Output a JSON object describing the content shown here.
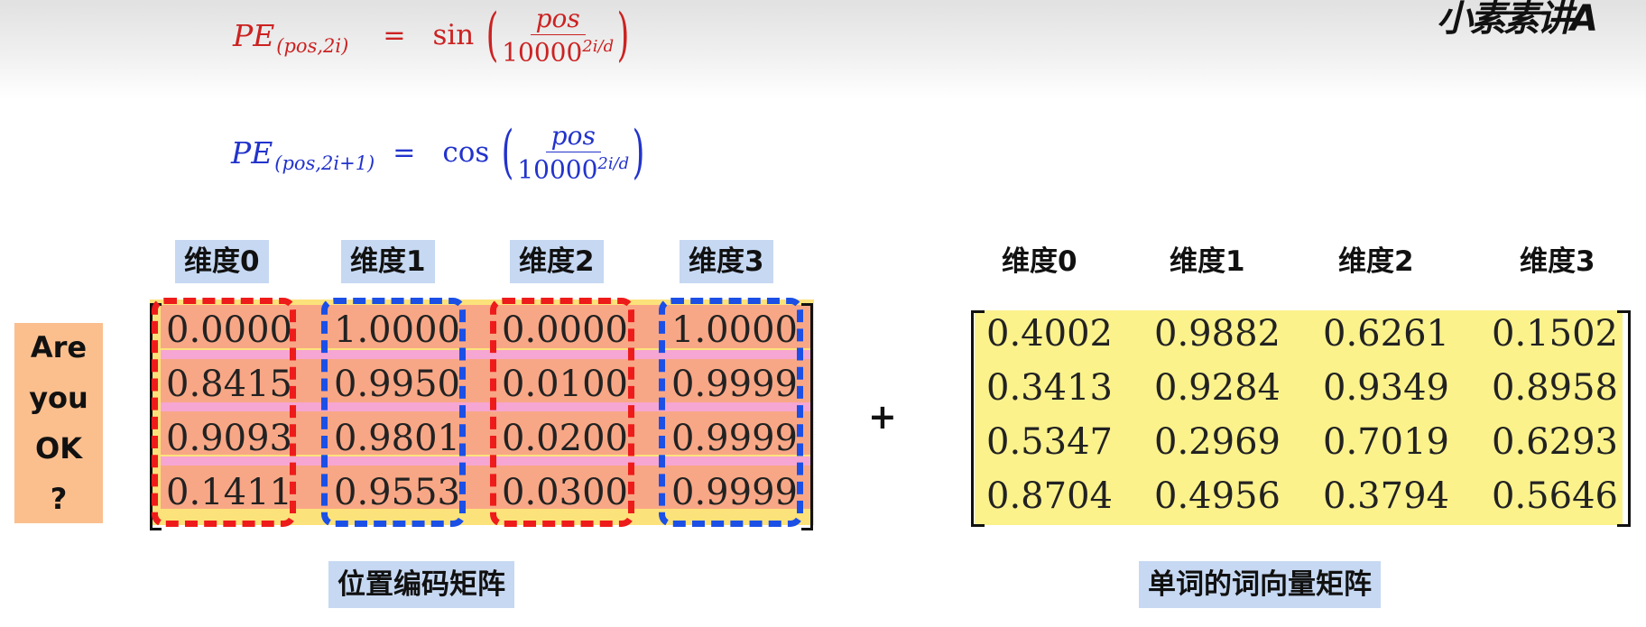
{
  "logo_text": "小素素讲A",
  "formulas": {
    "sin": {
      "pe": "PE",
      "subscript": "(pos,2i)",
      "equals": "=",
      "func": "sin",
      "numerator": "pos",
      "denominator_base": "10000",
      "denominator_exp": "2i/d",
      "paren_open": "(",
      "paren_close": ")"
    },
    "cos": {
      "pe": "PE",
      "subscript": "(pos,2i+1)",
      "equals": "=",
      "func": "cos",
      "numerator": "pos",
      "denominator_base": "10000",
      "denominator_exp": "2i/d",
      "paren_open": "(",
      "paren_close": ")"
    }
  },
  "position_encoding": {
    "dimension_labels": [
      "维度0",
      "维度1",
      "维度2",
      "维度3"
    ],
    "columns": [
      [
        "0.0000",
        "0.8415",
        "0.9093",
        "0.1411"
      ],
      [
        "1.0000",
        "0.9950",
        "0.9801",
        "0.9553"
      ],
      [
        "0.0000",
        "0.0100",
        "0.0200",
        "0.0300"
      ],
      [
        "1.0000",
        "0.9999",
        "0.9999",
        "0.9999"
      ]
    ],
    "column_outline_colors": [
      "#ee1b1b",
      "#1b4fe6",
      "#ee1b1b",
      "#1b4fe6"
    ],
    "caption": "位置编码矩阵"
  },
  "side_note": {
    "lines": [
      "Are",
      "you",
      "OK",
      "?"
    ],
    "color": "#fbbf8e"
  },
  "operator": "+",
  "word_vectors": {
    "dimension_labels": [
      "维度0",
      "维度1",
      "维度2",
      "维度3"
    ],
    "columns": [
      [
        "0.4002",
        "0.3413",
        "0.5347",
        "0.8704"
      ],
      [
        "0.9882",
        "0.9284",
        "0.2969",
        "0.4956"
      ],
      [
        "0.6261",
        "0.9349",
        "0.7019",
        "0.3794"
      ],
      [
        "0.1502",
        "0.8958",
        "0.6293",
        "0.5646"
      ]
    ],
    "caption": "单词的词向量矩阵"
  }
}
